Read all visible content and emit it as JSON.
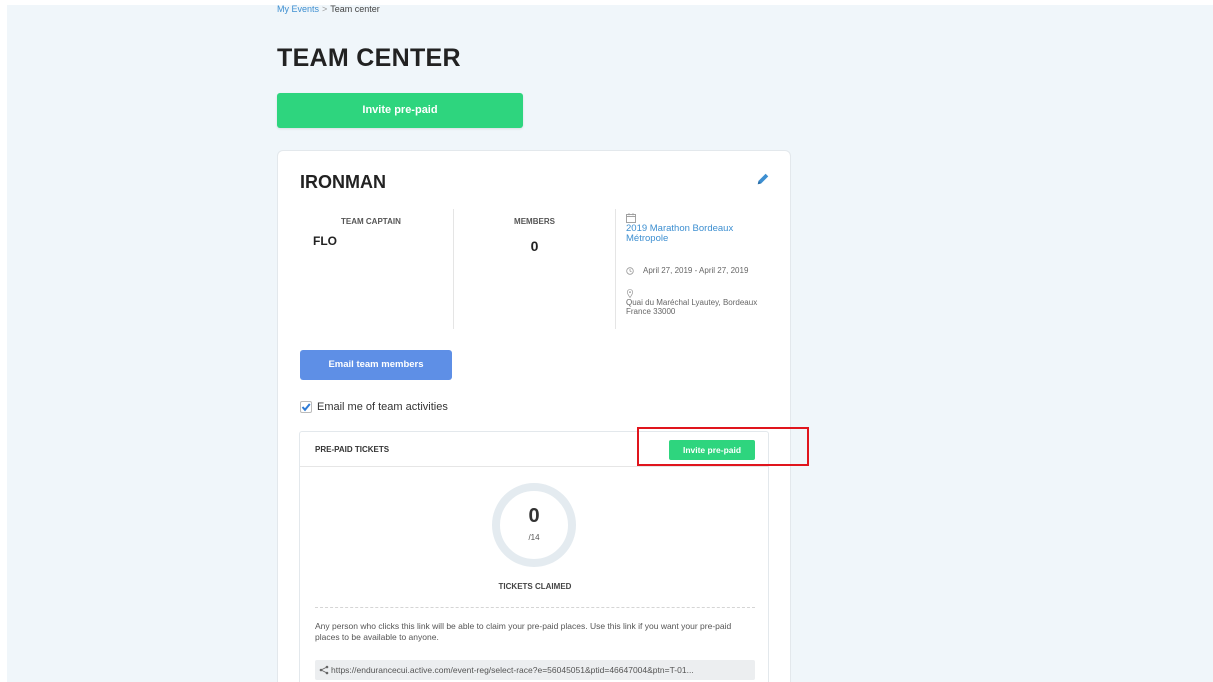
{
  "breadcrumb": {
    "parent": "My Events",
    "separator": ">",
    "current": "Team center"
  },
  "page": {
    "title": "TEAM CENTER"
  },
  "top_action": {
    "invite_label": "Invite pre-paid"
  },
  "team": {
    "name": "IRONMAN",
    "captain_label": "TEAM CAPTAIN",
    "captain_name": "FLO",
    "members_label": "MEMBERS",
    "members_count": "0",
    "event": {
      "name": "2019 Marathon Bordeaux Métropole",
      "date": "April 27, 2019 - April 27, 2019",
      "address": "Quai du Maréchal Lyautey, Bordeaux France 33000"
    },
    "email_button": "Email team members",
    "email_me_label": "Email me of team activities",
    "email_me_checked": true
  },
  "tickets": {
    "title": "PRE-PAID TICKETS",
    "invite_label": "Invite pre-paid",
    "claimed_count": "0",
    "claimed_total": "/14",
    "claimed_label": "TICKETS CLAIMED",
    "description": "Any person who clicks this link will be able to claim your pre-paid places. Use this link if you want your pre-paid places to be available to anyone.",
    "share_link": "https://endurancecui.active.com/event-reg/select-race?e=56045051&ptid=46647004&ptn=T-01..."
  },
  "colors": {
    "primary_green": "#2ed57e",
    "email_blue": "#5e8fe6",
    "link_blue": "#3d8fd1",
    "highlight_red": "#e0151d",
    "page_bg": "#f0f6fa"
  }
}
